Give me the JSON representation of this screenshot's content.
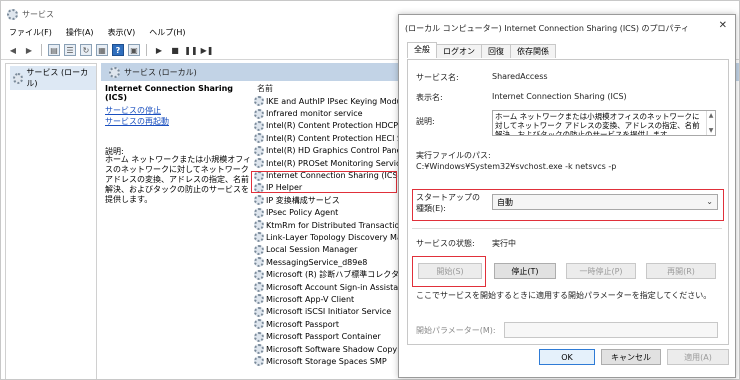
{
  "services_window": {
    "title": "サービス",
    "menu": [
      "ファイル(F)",
      "操作(A)",
      "表示(V)",
      "ヘルプ(H)"
    ],
    "tree_item": "サービス (ローカル)",
    "detail_header": "サービス (ローカル)",
    "selected_service_name": "Internet Connection Sharing (ICS)",
    "link_stop": "サービスの停止",
    "link_restart": "サービスの再起動",
    "description_label": "説明:",
    "description_text": "ホーム ネットワークまたは小規模オフィスのネットワークに対してネットワーク アドレスの変換、アドレスの指定、名前解決、およびタックの防止のサービスを提供します。",
    "name_column_header": "名前",
    "services": [
      "IKE and AuthIP IPsec Keying Modul",
      "Infrared monitor service",
      "Intel(R) Content Protection HDCP Se",
      "Intel(R) Content Protection HECI Se",
      "Intel(R) HD Graphics Control Panel S",
      "Intel(R) PROSet Monitoring Service",
      "Internet Connection Sharing (ICS)",
      "IP Helper",
      "IP 変換構成サービス",
      "IPsec Policy Agent",
      "KtmRm for Distributed Transaction C",
      "Link-Layer Topology Discovery Map",
      "Local Session Manager",
      "MessagingService_d89e8",
      "Microsoft (R) 診断ハブ標準コレクター",
      "Microsoft Account Sign-in Assistan",
      "Microsoft App-V Client",
      "Microsoft iSCSI Initiator Service",
      "Microsoft Passport",
      "Microsoft Passport Container",
      "Microsoft Software Shadow Copy P",
      "Microsoft Storage Spaces SMP"
    ]
  },
  "dialog": {
    "title": "(ローカル コンピューター) Internet Connection Sharing (ICS) のプロパティ",
    "close_glyph": "✕",
    "tabs": [
      "全般",
      "ログオン",
      "回復",
      "依存関係"
    ],
    "service_name_label": "サービス名:",
    "service_name_value": "SharedAccess",
    "display_name_label": "表示名:",
    "display_name_value": "Internet Connection Sharing (ICS)",
    "description_label": "説明:",
    "description_value": "ホーム ネットワークまたは小規模オフィスのネットワークに対してネットワーク アドレスの変換、アドレスの指定、名前解決、およびタックの防止のサービスを提供します",
    "exe_path_label": "実行ファイルのパス:",
    "exe_path_value": "C:¥Windows¥System32¥svchost.exe -k netsvcs -p",
    "startup_type_label_line1": "スタートアップの",
    "startup_type_label_line2": "種類(E):",
    "startup_type_value": "自動",
    "status_label": "サービスの状態:",
    "status_value": "実行中",
    "buttons": {
      "start": "開始(S)",
      "stop": "停止(T)",
      "pause": "一時停止(P)",
      "resume": "再開(R)"
    },
    "hint_text": "ここでサービスを開始するときに適用する開始パラメーターを指定してください。",
    "param_label": "開始パラメーター(M):",
    "param_value": "",
    "ok": "OK",
    "cancel": "キャンセル",
    "apply": "適用(A)"
  },
  "colors": {
    "highlight_red": "#e0303a",
    "link_blue": "#1a4fbf",
    "header_blue": "#c2d3e6",
    "primary_border": "#2e7bd6"
  }
}
